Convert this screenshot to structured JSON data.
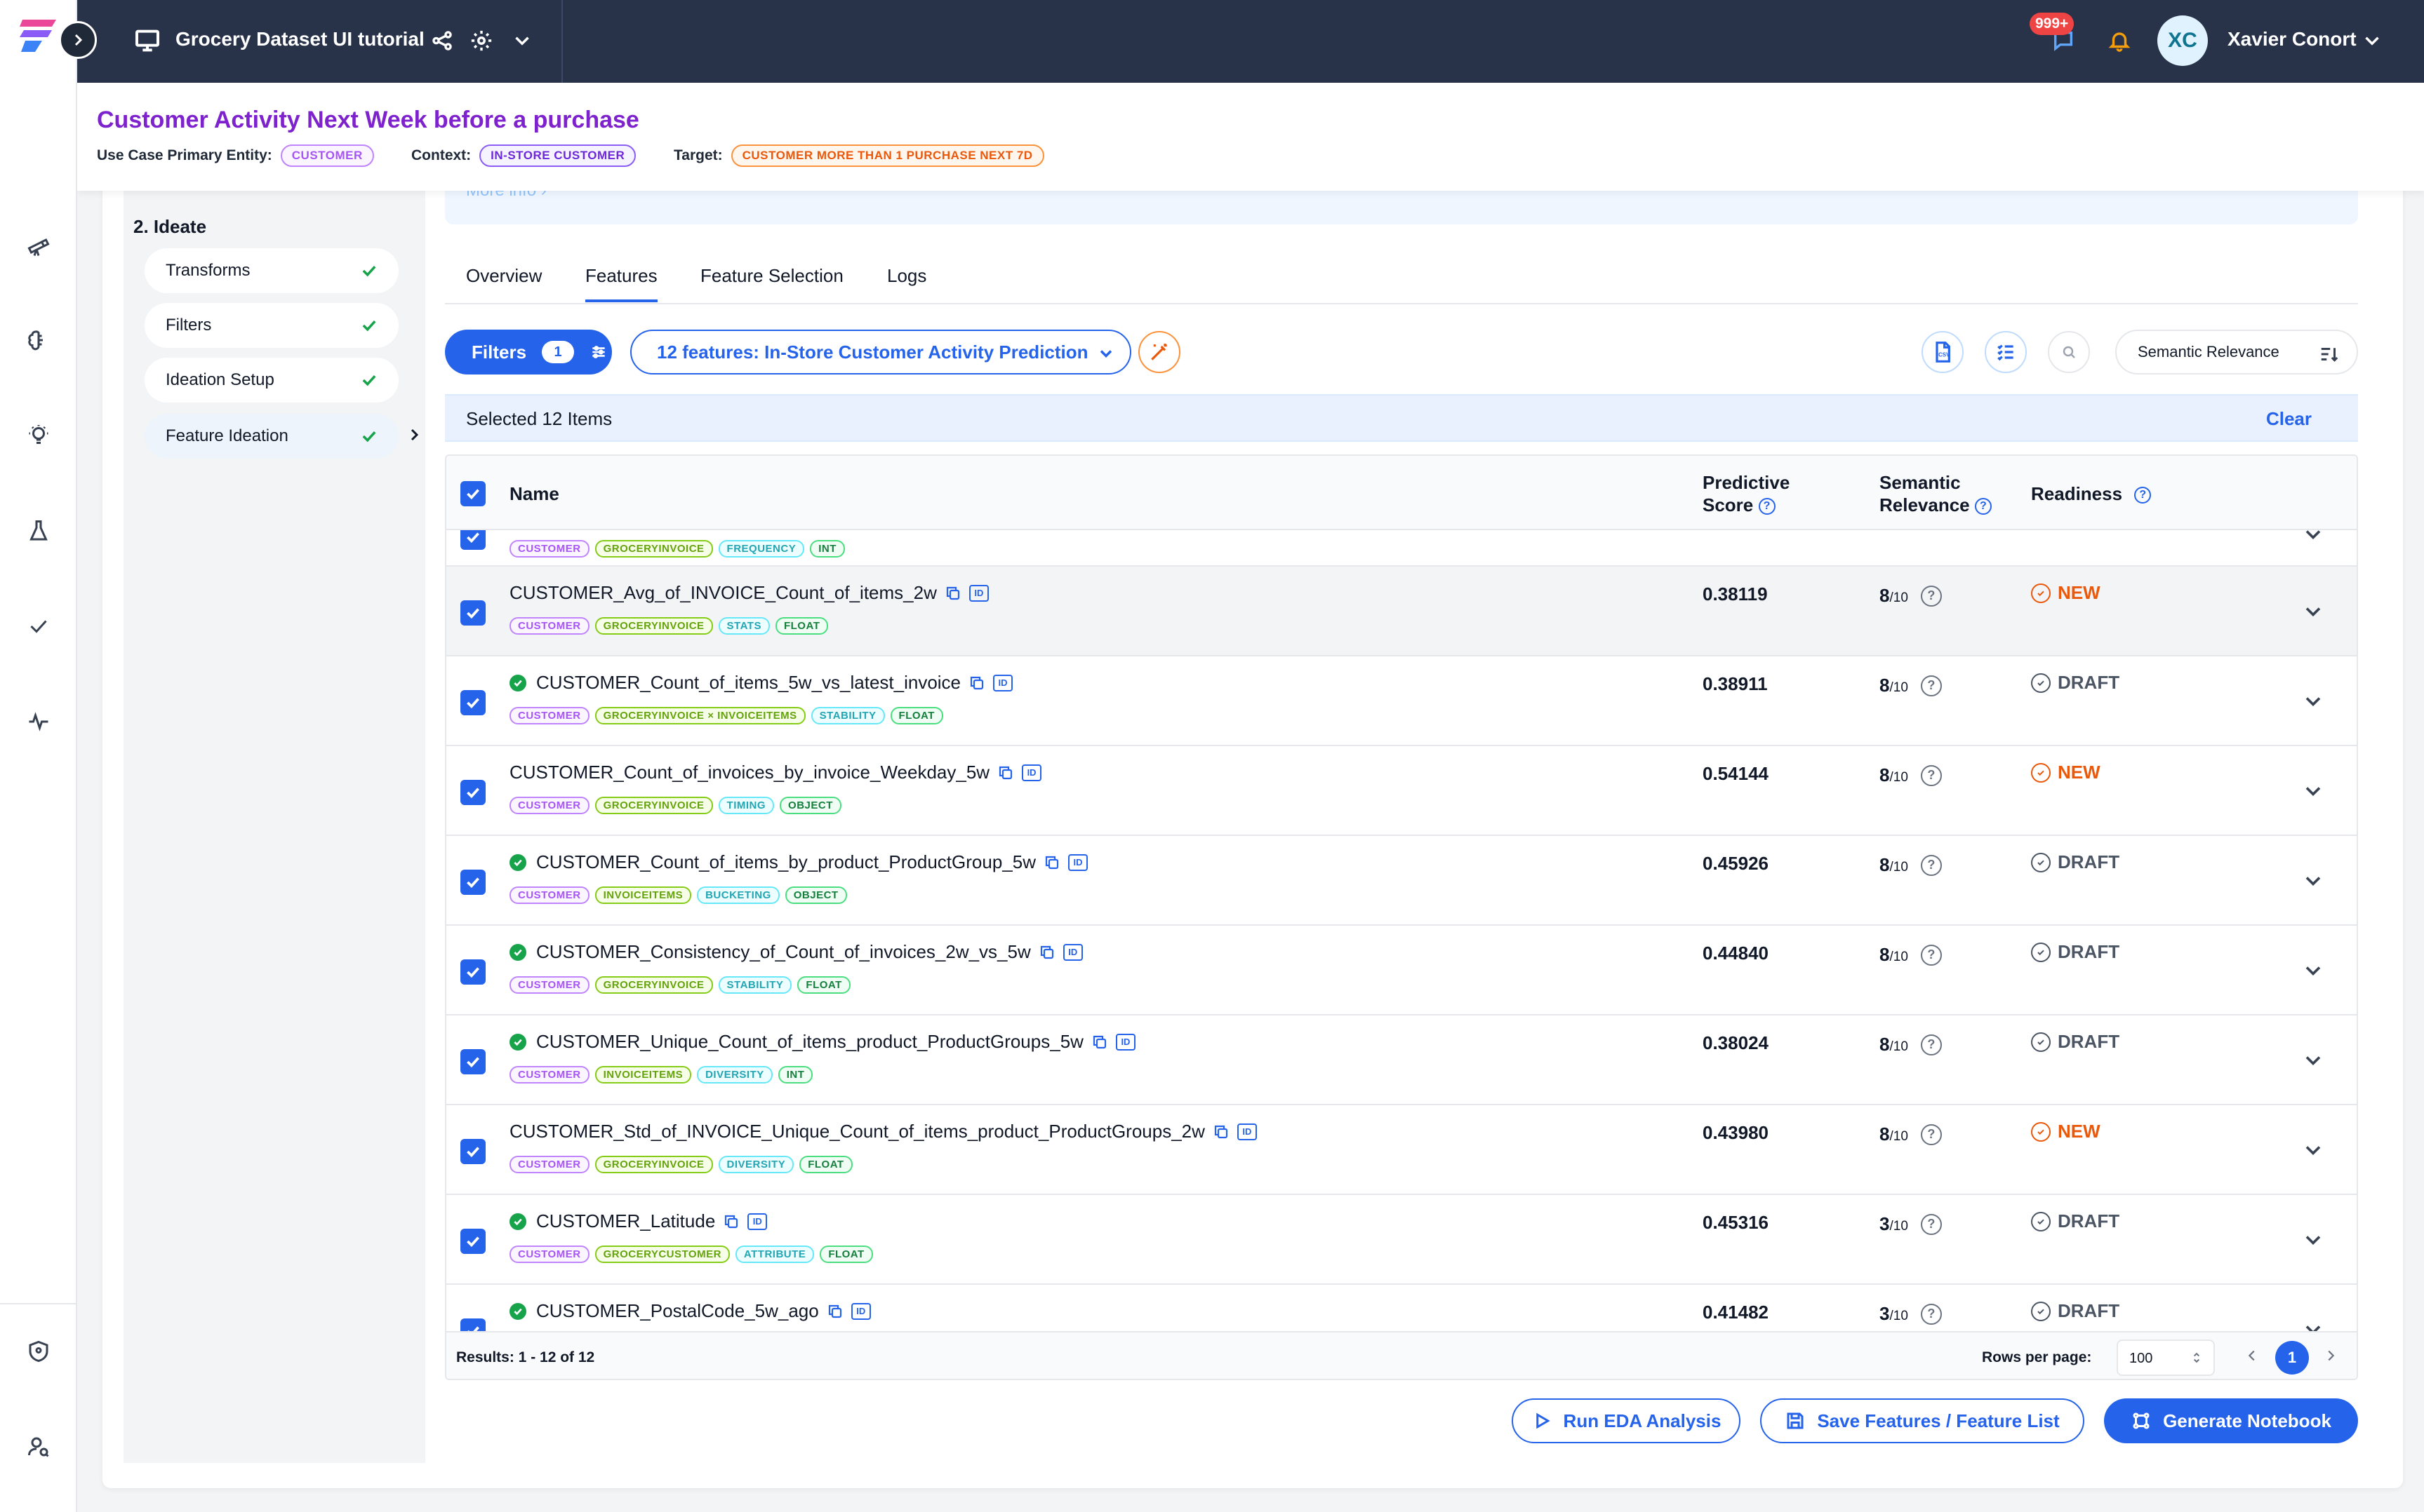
{
  "topbar": {
    "project_title": "Grocery Dataset UI tutorial",
    "notifications_badge": "999+",
    "user_initials": "XC",
    "user_name": "Xavier Conort"
  },
  "use_case": {
    "title": "Customer Activity Next Week before a purchase",
    "primary_entity_label": "Use Case Primary Entity:",
    "primary_entity": "CUSTOMER",
    "context_label": "Context:",
    "context": "IN-STORE CUSTOMER",
    "target_label": "Target:",
    "target": "CUSTOMER MORE THAN 1 PURCHASE NEXT 7D"
  },
  "sidebar": {
    "step_title": "2. Ideate",
    "steps": [
      {
        "label": "Transforms",
        "done": true
      },
      {
        "label": "Filters",
        "done": true
      },
      {
        "label": "Ideation Setup",
        "done": true
      },
      {
        "label": "Feature Ideation",
        "done": true
      }
    ]
  },
  "info_strip": {
    "more_info": "More info"
  },
  "tabs": [
    "Overview",
    "Features",
    "Feature Selection",
    "Logs"
  ],
  "active_tab": "Features",
  "toolbar": {
    "filters_label": "Filters",
    "filters_count": "1",
    "feature_list": "12 features: In-Store Customer Activity Prediction",
    "sort_label": "Semantic Relevance"
  },
  "selection": {
    "text": "Selected 12 Items",
    "clear": "Clear"
  },
  "table": {
    "headers": {
      "name": "Name",
      "predictive_score": "Predictive Score",
      "semantic_relevance": "Semantic Relevance",
      "readiness": "Readiness"
    },
    "partial_top_row": {
      "tags": [
        "CUSTOMER",
        "GROCERYINVOICE",
        "FREQUENCY",
        "INT"
      ]
    },
    "rows": [
      {
        "name": "CUSTOMER_Avg_of_INVOICE_Count_of_items_2w",
        "verified": false,
        "tags": [
          "CUSTOMER",
          "GROCERYINVOICE",
          "STATS",
          "FLOAT"
        ],
        "score": "0.38119",
        "relevance": "8",
        "relevance_den": "/10",
        "readiness": "NEW"
      },
      {
        "name": "CUSTOMER_Count_of_items_5w_vs_latest_invoice",
        "verified": true,
        "tags": [
          "CUSTOMER",
          "GROCERYINVOICE × INVOICEITEMS",
          "STABILITY",
          "FLOAT"
        ],
        "score": "0.38911",
        "relevance": "8",
        "relevance_den": "/10",
        "readiness": "DRAFT"
      },
      {
        "name": "CUSTOMER_Count_of_invoices_by_invoice_Weekday_5w",
        "verified": false,
        "tags": [
          "CUSTOMER",
          "GROCERYINVOICE",
          "TIMING",
          "OBJECT"
        ],
        "score": "0.54144",
        "relevance": "8",
        "relevance_den": "/10",
        "readiness": "NEW"
      },
      {
        "name": "CUSTOMER_Count_of_items_by_product_ProductGroup_5w",
        "verified": true,
        "tags": [
          "CUSTOMER",
          "INVOICEITEMS",
          "BUCKETING",
          "OBJECT"
        ],
        "score": "0.45926",
        "relevance": "8",
        "relevance_den": "/10",
        "readiness": "DRAFT"
      },
      {
        "name": "CUSTOMER_Consistency_of_Count_of_invoices_2w_vs_5w",
        "verified": true,
        "tags": [
          "CUSTOMER",
          "GROCERYINVOICE",
          "STABILITY",
          "FLOAT"
        ],
        "score": "0.44840",
        "relevance": "8",
        "relevance_den": "/10",
        "readiness": "DRAFT"
      },
      {
        "name": "CUSTOMER_Unique_Count_of_items_product_ProductGroups_5w",
        "verified": true,
        "tags": [
          "CUSTOMER",
          "INVOICEITEMS",
          "DIVERSITY",
          "INT"
        ],
        "score": "0.38024",
        "relevance": "8",
        "relevance_den": "/10",
        "readiness": "DRAFT"
      },
      {
        "name": "CUSTOMER_Std_of_INVOICE_Unique_Count_of_items_product_ProductGroups_2w",
        "verified": false,
        "tags": [
          "CUSTOMER",
          "GROCERYINVOICE",
          "DIVERSITY",
          "FLOAT"
        ],
        "score": "0.43980",
        "relevance": "8",
        "relevance_den": "/10",
        "readiness": "NEW"
      },
      {
        "name": "CUSTOMER_Latitude",
        "verified": true,
        "tags": [
          "CUSTOMER",
          "GROCERYCUSTOMER",
          "ATTRIBUTE",
          "FLOAT"
        ],
        "score": "0.45316",
        "relevance": "3",
        "relevance_den": "/10",
        "readiness": "DRAFT"
      },
      {
        "name": "CUSTOMER_PostalCode_5w_ago",
        "verified": true,
        "tags": [],
        "score": "0.41482",
        "relevance": "3",
        "relevance_den": "/10",
        "readiness": "DRAFT"
      }
    ],
    "footer": {
      "results": "Results: 1 - 12 of 12",
      "rows_per_page_label": "Rows per page:",
      "rows_per_page": "100",
      "current_page": "1"
    }
  },
  "actions": {
    "run_eda": "Run EDA Analysis",
    "save_features": "Save Features / Feature List",
    "generate_notebook": "Generate Notebook"
  },
  "colors": {
    "accent": "#2563eb",
    "topbar": "#28334a",
    "title_purple": "#7e22ce",
    "new_orange": "#ea580c",
    "check_green": "#16a34a"
  }
}
